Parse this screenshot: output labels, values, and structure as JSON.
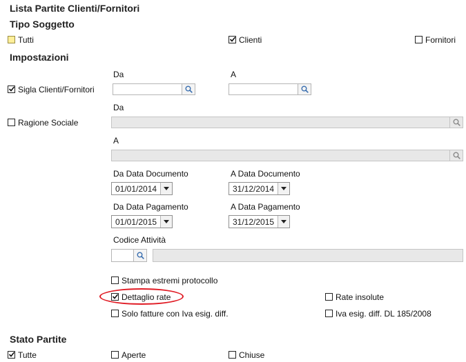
{
  "title": "Lista Partite Clienti/Fornitori",
  "tipo_soggetto": {
    "heading": "Tipo Soggetto",
    "tutti": {
      "label": "Tutti",
      "checked": false
    },
    "clienti": {
      "label": "Clienti",
      "checked": true
    },
    "fornitori": {
      "label": "Fornitori",
      "checked": false
    }
  },
  "impostazioni": {
    "heading": "Impostazioni",
    "da_label": "Da",
    "a_label": "A",
    "sigla": {
      "label": "Sigla Clienti/Fornitori",
      "checked": true,
      "da_value": "",
      "a_value": ""
    },
    "ragione_sociale": {
      "label": "Ragione Sociale",
      "checked": false,
      "da_label": "Da",
      "a_label": "A",
      "da_value": "",
      "a_value": ""
    },
    "da_data_documento": {
      "label": "Da Data Documento",
      "value": "01/01/2014"
    },
    "a_data_documento": {
      "label": "A Data Documento",
      "value": "31/12/2014"
    },
    "da_data_pagamento": {
      "label": "Da Data Pagamento",
      "value": "01/01/2015"
    },
    "a_data_pagamento": {
      "label": "A Data Pagamento",
      "value": "31/12/2015"
    },
    "codice_attivita": {
      "label": "Codice Attività",
      "value": "",
      "description": ""
    },
    "stampa_estremi": {
      "label": "Stampa estremi protocollo",
      "checked": false
    },
    "dettaglio_rate": {
      "label": "Dettaglio rate",
      "checked": true
    },
    "rate_insolute": {
      "label": "Rate insolute",
      "checked": false
    },
    "solo_fatture": {
      "label": "Solo fatture con Iva esig. diff.",
      "checked": false
    },
    "iva_esig": {
      "label": "Iva esig. diff. DL 185/2008",
      "checked": false
    }
  },
  "stato_partite": {
    "heading": "Stato Partite",
    "tutte": {
      "label": "Tutte",
      "checked": true
    },
    "aperte": {
      "label": "Aperte",
      "checked": false
    },
    "chiuse": {
      "label": "Chiuse",
      "checked": false
    }
  },
  "colors": {
    "highlight_ellipse": "#e01b24",
    "tutti_checkbox": "#ffef9a"
  }
}
